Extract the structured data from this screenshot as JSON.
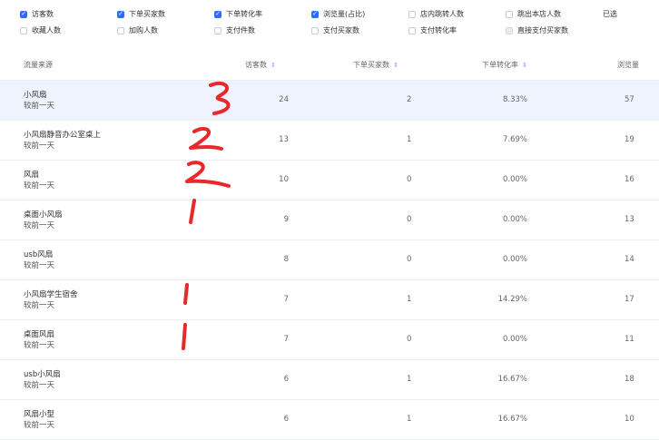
{
  "filters": {
    "row1": [
      {
        "label": "访客数",
        "checked": true
      },
      {
        "label": "下单买家数",
        "checked": true
      },
      {
        "label": "下单转化率",
        "checked": true
      },
      {
        "label": "浏览量(占比)",
        "checked": true
      },
      {
        "label": "店内跳转人数",
        "checked": false
      },
      {
        "label": "跳出本店人数",
        "checked": false
      },
      {
        "label": "已选"
      }
    ],
    "row2": [
      {
        "label": "收藏人数",
        "checked": false
      },
      {
        "label": "加购人数",
        "checked": false
      },
      {
        "label": "支付件数",
        "checked": false
      },
      {
        "label": "支付买家数",
        "checked": false
      },
      {
        "label": "支付转化率",
        "checked": false
      },
      {
        "label": "直接支付买家数",
        "checked": false,
        "disabled": true
      }
    ]
  },
  "table": {
    "headers": [
      "流量来源",
      "访客数",
      "下单买家数",
      "下单转化率",
      "浏览量"
    ],
    "sub_label": "较前一天",
    "rows": [
      {
        "source": "小风扇",
        "visitors": "24",
        "buyers": "2",
        "conversion": "8.33%",
        "views": "57"
      },
      {
        "source": "小风扇静音办公室桌上",
        "visitors": "13",
        "buyers": "1",
        "conversion": "7.69%",
        "views": "19"
      },
      {
        "source": "风扇",
        "visitors": "10",
        "buyers": "0",
        "conversion": "0.00%",
        "views": "16"
      },
      {
        "source": "桌面小风扇",
        "visitors": "9",
        "buyers": "0",
        "conversion": "0.00%",
        "views": "13"
      },
      {
        "source": "usb风扇",
        "visitors": "8",
        "buyers": "0",
        "conversion": "0.00%",
        "views": "14"
      },
      {
        "source": "小风扇学生宿舍",
        "visitors": "7",
        "buyers": "1",
        "conversion": "14.29%",
        "views": "17"
      },
      {
        "source": "桌面风扇",
        "visitors": "7",
        "buyers": "0",
        "conversion": "0.00%",
        "views": "11"
      },
      {
        "source": "usb小风扇",
        "visitors": "6",
        "buyers": "1",
        "conversion": "16.67%",
        "views": "18"
      },
      {
        "source": "风扇小型",
        "visitors": "6",
        "buyers": "1",
        "conversion": "16.67%",
        "views": "10"
      }
    ]
  },
  "annotations": {
    "color": "#e8282c",
    "marks": [
      "3",
      "2",
      "2",
      "1",
      "1",
      "1"
    ]
  }
}
